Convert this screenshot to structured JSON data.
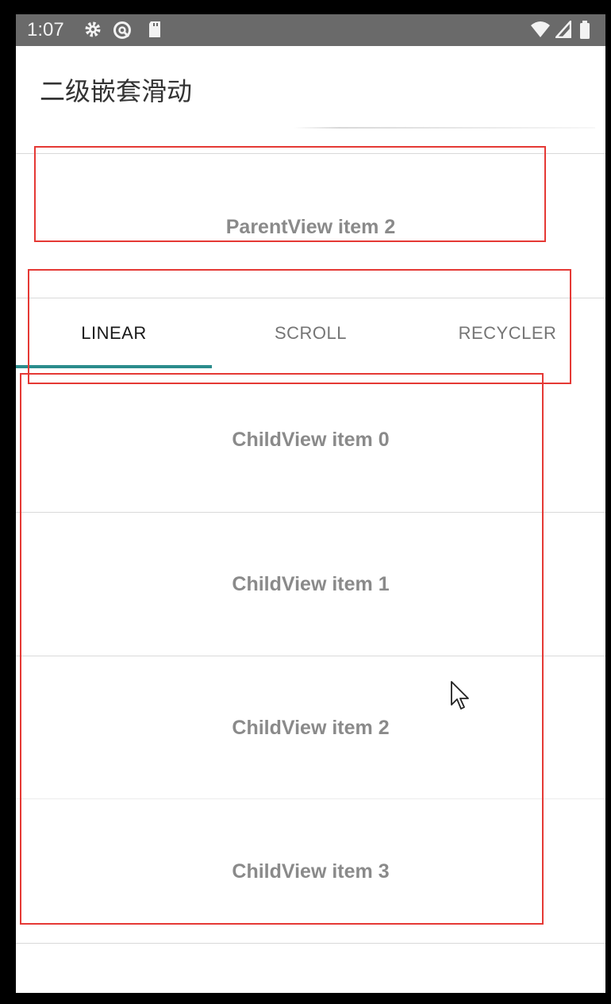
{
  "status_bar": {
    "time": "1:07",
    "icons": [
      "gear-icon",
      "at-sign-icon",
      "sd-card-icon",
      "wifi-icon",
      "cellular-icon",
      "battery-icon"
    ]
  },
  "app_bar": {
    "title": "二级嵌套滑动"
  },
  "parent_list": {
    "items": [
      {
        "label": "ParentView item 2"
      }
    ]
  },
  "tabs": [
    {
      "label": "LINEAR",
      "active": true
    },
    {
      "label": "SCROLL",
      "active": false
    },
    {
      "label": "RECYCLER",
      "active": false
    }
  ],
  "child_list": {
    "items": [
      {
        "label": "ChildView item 0"
      },
      {
        "label": "ChildView item 1"
      },
      {
        "label": "ChildView item 2"
      },
      {
        "label": "ChildView item 3"
      }
    ]
  },
  "colors": {
    "status_bar": "#6a6a6a",
    "tab_indicator": "#2a8c8c",
    "annotation_box": "#e53935",
    "item_text": "#8a8a8a"
  }
}
